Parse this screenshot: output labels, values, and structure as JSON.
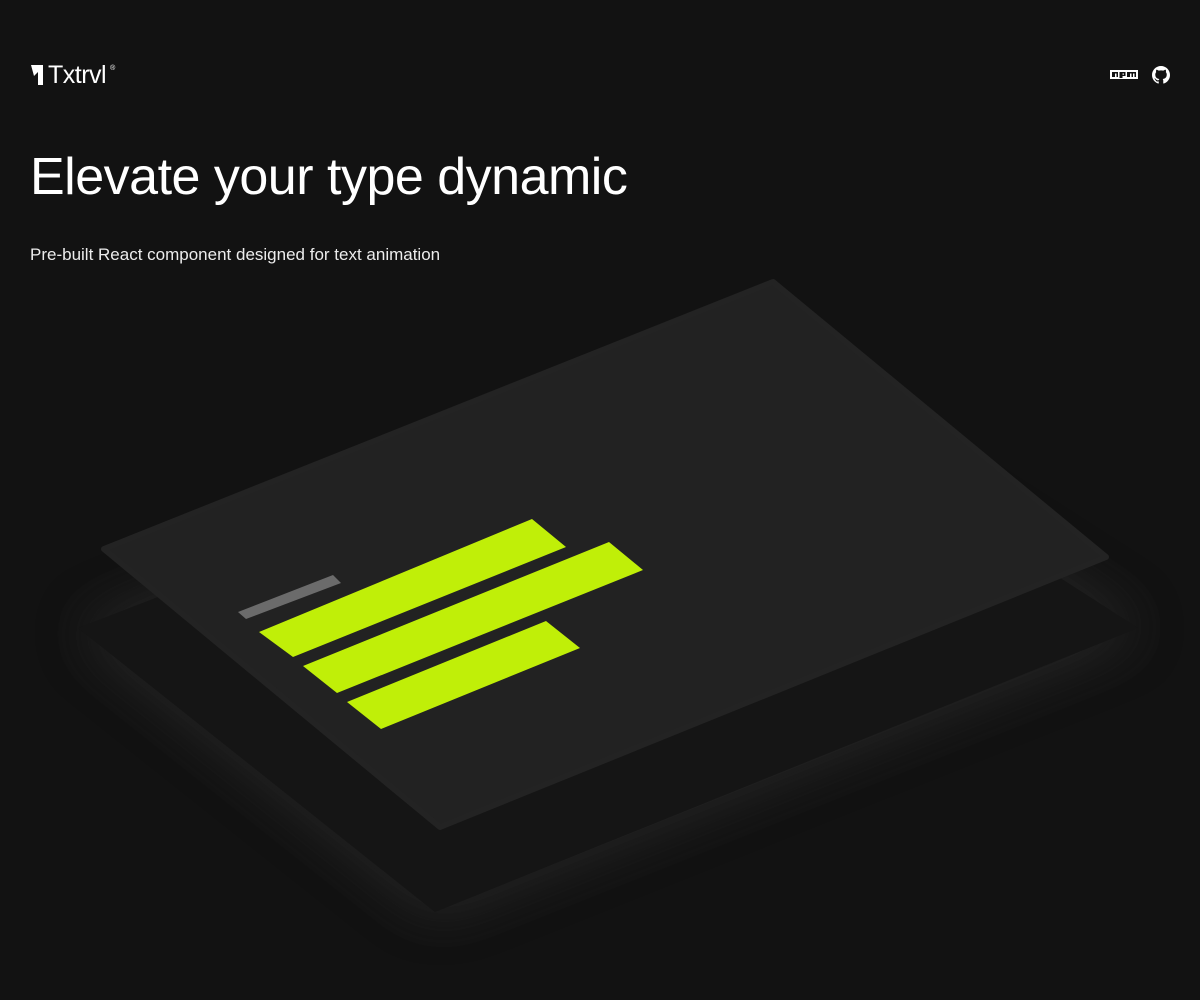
{
  "brand": {
    "name": "Txtrvl",
    "registered": "®"
  },
  "nav": {
    "icons": [
      "npm-icon",
      "github-icon"
    ]
  },
  "hero": {
    "title": "Elevate your type dynamic",
    "subtitle": "Pre-built React component designed for text animation"
  },
  "colors": {
    "background": "#121212",
    "card": "#222222",
    "card_shadow_layer": "#151515",
    "accent": "#c0ef08",
    "muted_bar": "#6b6b6b",
    "text": "#ffffff"
  }
}
